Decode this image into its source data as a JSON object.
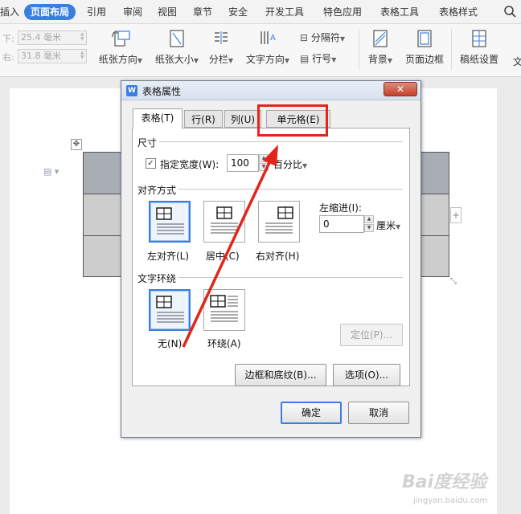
{
  "menu_tabs": [
    "插入",
    "页面布局",
    "引用",
    "审阅",
    "视图",
    "章节",
    "安全",
    "开发工具",
    "特色应用",
    "表格工具",
    "表格样式",
    "文"
  ],
  "active_menu_tab": "页面布局",
  "ribbon": {
    "margin_bottom_label": "下:",
    "margin_bottom_value": "25.4 毫米",
    "margin_right_label": "右:",
    "margin_right_value": "31.8 毫米",
    "paper_orientation": "纸张方向",
    "paper_size": "纸张大小",
    "columns": "分栏",
    "text_direction": "文字方向",
    "separator": "分隔符",
    "line_number": "行号",
    "background": "背景",
    "page_border": "页面边框",
    "grid_paper": "稿纸设置",
    "more": "文"
  },
  "dialog": {
    "title": "表格属性",
    "app_icon": "W",
    "close_label": "✕",
    "tabs": [
      "表格(T)",
      "行(R)",
      "列(U)",
      "单元格(E)"
    ],
    "active_tab": "表格(T)",
    "size_group": "尺寸",
    "specify_width_label": "指定宽度(W):",
    "specify_width_checked": true,
    "width_value": "100",
    "width_unit": "百分比",
    "align_group": "对齐方式",
    "align_options": [
      "左对齐(L)",
      "居中(C)",
      "右对齐(H)"
    ],
    "align_selected": "左对齐(L)",
    "indent_label": "左缩进(I):",
    "indent_value": "0",
    "indent_unit": "厘米",
    "wrap_group": "文字环绕",
    "wrap_options": [
      "无(N)",
      "环绕(A)"
    ],
    "wrap_selected": "无(N)",
    "position_button": "定位(P)...",
    "borders_button": "边框和底纹(B)...",
    "options_button": "选项(O)...",
    "ok_button": "确定",
    "cancel_button": "取消"
  },
  "annotation": {
    "highlight_color": "#e3241b",
    "highlighted_tab": "单元格(E)"
  },
  "watermark": {
    "brand": "Bai度经验",
    "site": "jingyan.baidu.com"
  },
  "colors": {
    "accent": "#3a7fe0",
    "table_fill": "#cdcdcd",
    "table_selected_fill": "#a9aeb5"
  }
}
